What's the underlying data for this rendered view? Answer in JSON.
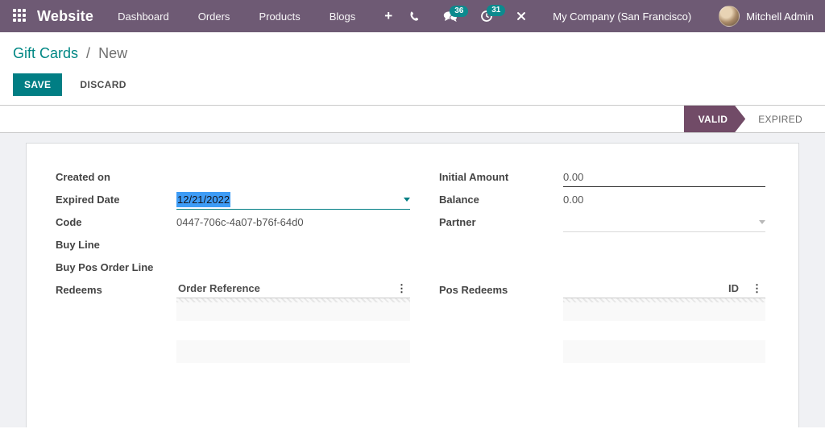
{
  "colors": {
    "navbar_bg": "#6e5a74",
    "primary_teal": "#017e84",
    "link_teal": "#008784",
    "badge_teal": "#0c8a8e",
    "status_arrow_purple": "#714b67",
    "selection_blue": "#3e9cf6",
    "content_bg": "#f0f1f4"
  },
  "navbar": {
    "app_name": "Website",
    "menu": [
      "Dashboard",
      "Orders",
      "Products",
      "Blogs"
    ],
    "plus_label": "+",
    "messages_badge": "36",
    "activities_badge": "31",
    "company": "My Company (San Francisco)",
    "user": "Mitchell Admin"
  },
  "breadcrumb": {
    "parent": "Gift Cards",
    "separator": "/",
    "current": "New"
  },
  "actions": {
    "save": "SAVE",
    "discard": "DISCARD"
  },
  "statusbar": {
    "valid": "VALID",
    "expired": "EXPIRED"
  },
  "icons": {
    "kebab": "⋮"
  },
  "form": {
    "created_on": {
      "label": "Created on",
      "value": ""
    },
    "expired_date": {
      "label": "Expired Date",
      "value": "12/21/2022"
    },
    "code": {
      "label": "Code",
      "value": "0447-706c-4a07-b76f-64d0"
    },
    "buy_line": {
      "label": "Buy Line"
    },
    "buy_pos_order_line": {
      "label": "Buy Pos Order Line"
    },
    "redeems": {
      "label": "Redeems",
      "table_header": "Order Reference"
    },
    "initial_amount": {
      "label": "Initial Amount",
      "value": "0.00"
    },
    "balance": {
      "label": "Balance",
      "value": "0.00"
    },
    "partner": {
      "label": "Partner",
      "value": ""
    },
    "pos_redeems": {
      "label": "Pos Redeems",
      "table_header": "ID"
    }
  }
}
